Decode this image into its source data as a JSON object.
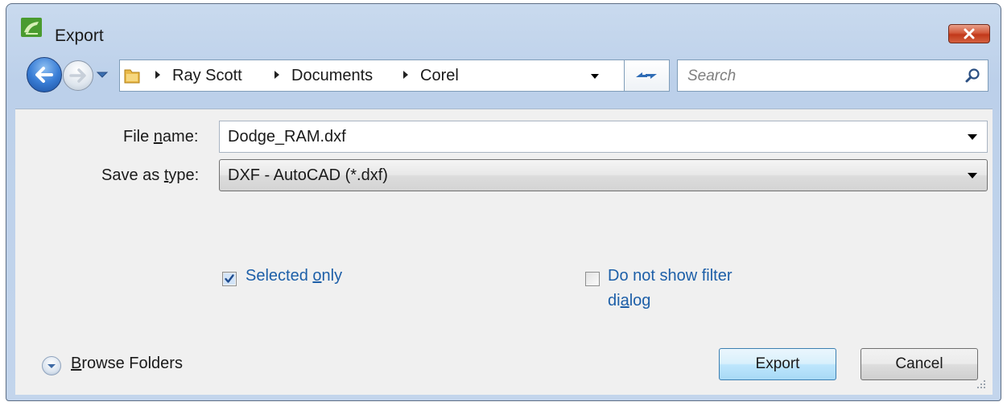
{
  "window": {
    "title": "Export"
  },
  "nav": {
    "breadcrumbs": [
      "Ray Scott",
      "Documents",
      "Corel"
    ],
    "search_placeholder": "Search"
  },
  "form": {
    "file_name_label_pre": "File ",
    "file_name_label_u": "n",
    "file_name_label_post": "ame:",
    "file_name_value": "Dodge_RAM.dxf",
    "save_type_label_pre": "Save as ",
    "save_type_label_u": "t",
    "save_type_label_post": "ype:",
    "save_type_value": "DXF - AutoCAD (*.dxf)"
  },
  "options": {
    "selected_only_pre": "Selected ",
    "selected_only_u": "o",
    "selected_only_post": "nly",
    "selected_only_checked": true,
    "filter_line1": "Do not show filter",
    "filter_line2_pre": "di",
    "filter_line2_u": "a",
    "filter_line2_post": "log",
    "filter_checked": false
  },
  "footer": {
    "browse_u": "B",
    "browse_post": "rowse Folders",
    "export_label": "Export",
    "cancel_label": "Cancel"
  },
  "colors": {
    "link_blue": "#1d5fa8",
    "close_red": "#c1381a",
    "frame_blue": "#bcd0ea"
  },
  "icons": [
    "corel-app-icon",
    "close-icon",
    "back-arrow-icon",
    "forward-arrow-icon",
    "chevron-down-icon",
    "folder-icon",
    "breadcrumb-arrow-icon",
    "refresh-icon",
    "search-icon",
    "checkmark-icon",
    "expand-icon",
    "resize-grip-icon"
  ]
}
